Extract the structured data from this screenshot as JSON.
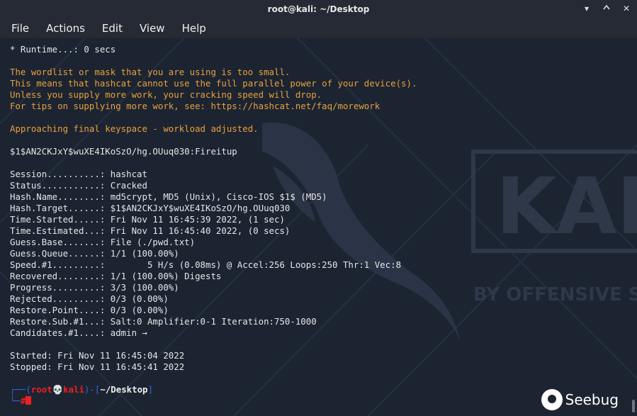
{
  "window": {
    "title": "root@kali: ~/Desktop",
    "controls": [
      "minimize-icon",
      "maximize-icon",
      "close-icon"
    ]
  },
  "menu": {
    "items": [
      "File",
      "Actions",
      "Edit",
      "View",
      "Help"
    ]
  },
  "terminal": {
    "lines": [
      {
        "text": "* Runtime...: 0 secs",
        "style": "normal"
      },
      {
        "text": "",
        "style": "normal"
      },
      {
        "text": "The wordlist or mask that you are using is too small.",
        "style": "warn"
      },
      {
        "text": "This means that hashcat cannot use the full parallel power of your device(s).",
        "style": "warn"
      },
      {
        "text": "Unless you supply more work, your cracking speed will drop.",
        "style": "warn"
      },
      {
        "text": "For tips on supplying more work, see: https://hashcat.net/faq/morework",
        "style": "warn"
      },
      {
        "text": "",
        "style": "normal"
      },
      {
        "text": "Approaching final keyspace - workload adjusted.",
        "style": "warn"
      },
      {
        "text": "",
        "style": "normal"
      },
      {
        "text": "$1$AN2CKJxY$wuXE4IKoSzO/hg.OUuq030:Fireitup",
        "style": "normal"
      },
      {
        "text": "",
        "style": "normal"
      },
      {
        "text": "Session..........: hashcat",
        "style": "normal"
      },
      {
        "text": "Status...........: Cracked",
        "style": "normal"
      },
      {
        "text": "Hash.Name........: md5crypt, MD5 (Unix), Cisco-IOS $1$ (MD5)",
        "style": "normal"
      },
      {
        "text": "Hash.Target......: $1$AN2CKJxY$wuXE4IKoSzO/hg.OUuq030",
        "style": "normal"
      },
      {
        "text": "Time.Started.....: Fri Nov 11 16:45:39 2022, (1 sec)",
        "style": "normal"
      },
      {
        "text": "Time.Estimated...: Fri Nov 11 16:45:40 2022, (0 secs)",
        "style": "normal"
      },
      {
        "text": "Guess.Base.......: File (./pwd.txt)",
        "style": "normal"
      },
      {
        "text": "Guess.Queue......: 1/1 (100.00%)",
        "style": "normal"
      },
      {
        "text": "Speed.#1.........:        5 H/s (0.08ms) @ Accel:256 Loops:250 Thr:1 Vec:8",
        "style": "normal"
      },
      {
        "text": "Recovered........: 1/1 (100.00%) Digests",
        "style": "normal"
      },
      {
        "text": "Progress.........: 3/3 (100.00%)",
        "style": "normal"
      },
      {
        "text": "Rejected.........: 0/3 (0.00%)",
        "style": "normal"
      },
      {
        "text": "Restore.Point....: 0/3 (0.00%)",
        "style": "normal"
      },
      {
        "text": "Restore.Sub.#1...: Salt:0 Amplifier:0-1 Iteration:750-1000",
        "style": "normal"
      },
      {
        "text": "Candidates.#1....: admin →",
        "style": "normal"
      },
      {
        "text": "",
        "style": "normal"
      },
      {
        "text": "Started: Fri Nov 11 16:45:04 2022",
        "style": "normal"
      },
      {
        "text": "Stopped: Fri Nov 11 16:45:41 2022",
        "style": "normal"
      },
      {
        "text": "",
        "style": "normal"
      }
    ],
    "prompt": {
      "open": "┌──(",
      "user": "root",
      "skull": "💀",
      "host": "kali",
      "mid": ")-[",
      "cwd": "~/Desktop",
      "close": "]",
      "second_line": "└─",
      "symbol": "#"
    }
  },
  "watermark": {
    "text": "Seebug"
  },
  "background": {
    "brand_text_1": "KAL",
    "brand_text_2": "BY OFFENSIVE S"
  },
  "colors": {
    "background": "#1c2432",
    "warning": "#e8a13a",
    "prompt_frame": "#3465d4",
    "root_user": "#ee2020"
  }
}
